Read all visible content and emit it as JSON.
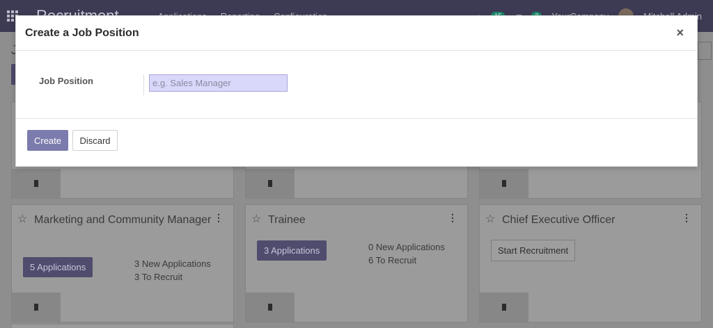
{
  "navbar": {
    "brand": "Recruitment",
    "menu": [
      "Applications",
      "Reporting",
      "Configuration"
    ],
    "activity_count": "15",
    "message_count": "3",
    "company": "YourCompany",
    "user": "Mitchell Admin"
  },
  "page": {
    "title": "J"
  },
  "cards": [
    {
      "title": "Marketing and Community Manager",
      "applications_label": "5 Applications",
      "new_applications": "3 New Applications",
      "to_recruit": "3 To Recruit"
    },
    {
      "title": "Trainee",
      "applications_label": "3 Applications",
      "new_applications": "0 New Applications",
      "to_recruit": "6 To Recruit"
    },
    {
      "title": "Chief Executive Officer",
      "start_label": "Start Recruitment"
    }
  ],
  "modal": {
    "title": "Create a Job Position",
    "close_glyph": "×",
    "field_label": "Job Position",
    "field_placeholder": "e.g. Sales Manager",
    "create_label": "Create",
    "discard_label": "Discard"
  }
}
